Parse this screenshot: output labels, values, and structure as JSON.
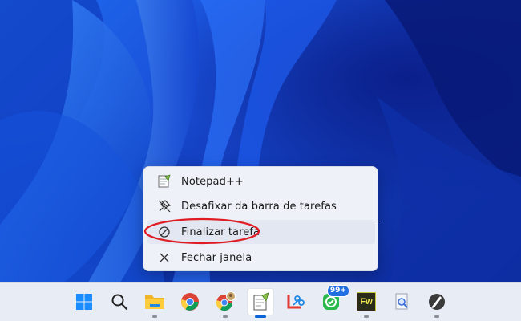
{
  "context_menu": {
    "items": [
      {
        "label": "Notepad++",
        "icon": "notepad-plus-plus-icon"
      },
      {
        "label": "Desafixar da barra de tarefas",
        "icon": "unpin-icon"
      },
      {
        "label": "Finalizar tarefa",
        "icon": "end-task-icon",
        "highlighted": true
      },
      {
        "label": "Fechar janela",
        "icon": "close-icon"
      }
    ],
    "highlight_color": "#e01b24"
  },
  "taskbar": {
    "items": [
      {
        "name": "start",
        "icon": "windows-logo-icon"
      },
      {
        "name": "search",
        "icon": "search-icon"
      },
      {
        "name": "file-explorer",
        "icon": "folder-icon",
        "running": true
      },
      {
        "name": "chrome",
        "icon": "chrome-icon"
      },
      {
        "name": "chrome-profile",
        "icon": "chrome-profile-icon",
        "running": true
      },
      {
        "name": "notepad-plus-plus",
        "icon": "notepad-plus-plus-icon",
        "running": true,
        "active": true
      },
      {
        "name": "snipping-tool",
        "icon": "snipping-tool-icon"
      },
      {
        "name": "messaging",
        "icon": "messaging-icon",
        "badge": "99+"
      },
      {
        "name": "fireworks",
        "icon": "fireworks-icon",
        "label": "Fw",
        "running": true
      },
      {
        "name": "magnifier",
        "icon": "magnifier-icon"
      },
      {
        "name": "inkscape",
        "icon": "inkscape-icon",
        "running": true
      }
    ],
    "accent": "#0a64d8"
  }
}
